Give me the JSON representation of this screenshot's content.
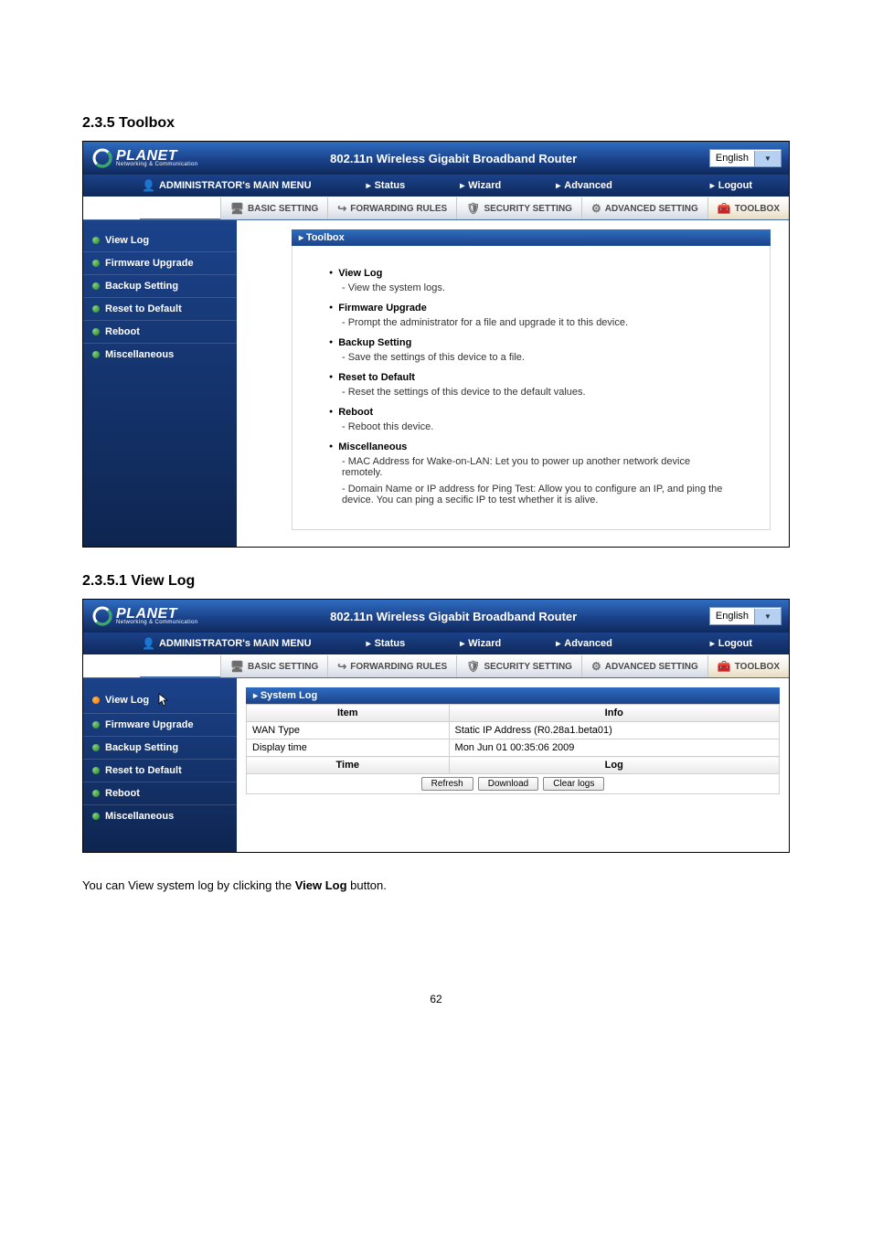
{
  "headings": {
    "toolbox": "2.3.5 Toolbox",
    "viewlog": "2.3.5.1 View Log"
  },
  "header": {
    "brand": "PLANET",
    "tagline": "Networking & Communication",
    "title": "802.11n Wireless Gigabit Broadband Router",
    "language": "English"
  },
  "main_menu": {
    "admin_label": "ADMINISTRATOR's MAIN MENU",
    "items": [
      "Status",
      "Wizard",
      "Advanced"
    ],
    "logout": "Logout"
  },
  "tabs": {
    "basic": "BASIC SETTING",
    "forwarding": "FORWARDING RULES",
    "security": "SECURITY SETTING",
    "advanced": "ADVANCED SETTING",
    "toolbox": "TOOLBOX"
  },
  "sidebar": {
    "items": [
      {
        "label": "View Log"
      },
      {
        "label": "Firmware Upgrade"
      },
      {
        "label": "Backup Setting"
      },
      {
        "label": "Reset to Default"
      },
      {
        "label": "Reboot"
      },
      {
        "label": "Miscellaneous"
      }
    ]
  },
  "shot1": {
    "panel_title": "Toolbox",
    "items": [
      {
        "title": "View Log",
        "desc": "- View the system logs."
      },
      {
        "title": "Firmware Upgrade",
        "desc": "- Prompt the administrator for a file and upgrade it to this device."
      },
      {
        "title": "Backup Setting",
        "desc": "- Save the settings of this device to a file."
      },
      {
        "title": "Reset to Default",
        "desc": "- Reset the settings of this device to the default values."
      },
      {
        "title": "Reboot",
        "desc": "- Reboot this device."
      },
      {
        "title": "Miscellaneous",
        "desc1": "- MAC Address for Wake-on-LAN: Let you to power up another network device remotely.",
        "desc2": "- Domain Name or IP address for Ping Test: Allow you to configure an IP, and ping the device. You can ping a secific IP to test whether it is alive."
      }
    ]
  },
  "shot2": {
    "panel_title": "System Log",
    "head_item": "Item",
    "head_info": "Info",
    "row1_item": "WAN Type",
    "row1_info": "Static IP Address (R0.28a1.beta01)",
    "row2_item": "Display time",
    "row2_info": "Mon Jun 01 00:35:06 2009",
    "head_time": "Time",
    "head_log": "Log",
    "btn_refresh": "Refresh",
    "btn_download": "Download",
    "btn_clear": "Clear logs"
  },
  "caption": {
    "prefix": "You can View system log by clicking the ",
    "bold": "View Log",
    "suffix": " button."
  },
  "page_number": "62"
}
